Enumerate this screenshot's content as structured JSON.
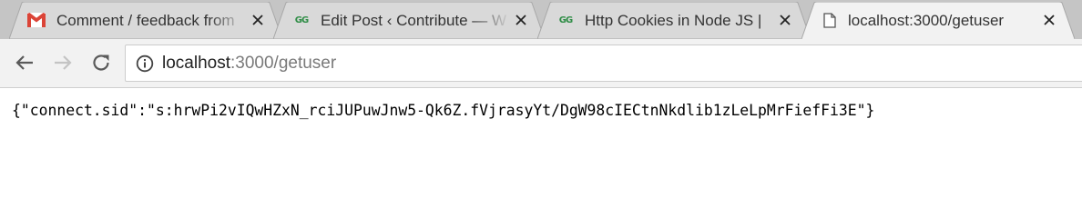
{
  "tabs": [
    {
      "title": "Comment / feedback from",
      "favicon": "gmail-icon",
      "active": false
    },
    {
      "title": "Edit Post ‹ Contribute — W",
      "favicon": "gfg-icon",
      "active": false
    },
    {
      "title": "Http Cookies in Node JS |",
      "favicon": "gfg-icon",
      "active": false
    },
    {
      "title": "localhost:3000/getuser",
      "favicon": "page-icon",
      "active": true
    }
  ],
  "favicon_gfg_text": "GG",
  "omnibox": {
    "host": "localhost",
    "rest": ":3000/getuser"
  },
  "page": {
    "body_text": "{\"connect.sid\":\"s:hrwPi2vIQwHZxN_rciJUPuwJnw5-Qk6Z.fVjrasyYt/DgW98cIECtnNkdlib1zLeLpMrFiefFi3E\"}"
  },
  "colors": {
    "tabstrip": "#c5c5c5",
    "inactive_tab": "#d9d9d9",
    "active_tab": "#f2f2f2",
    "gmail_red": "#db4437",
    "gfg_green": "#2f8d46"
  }
}
